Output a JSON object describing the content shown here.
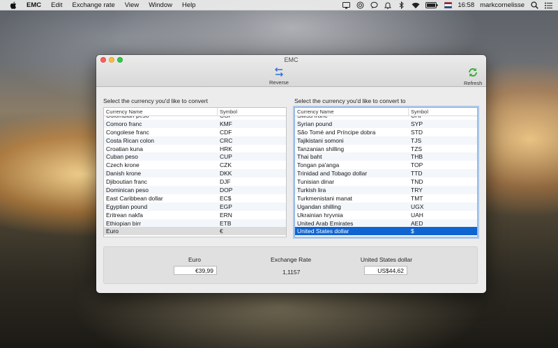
{
  "menubar": {
    "apple": "apple-logo",
    "items": [
      "EMC",
      "Edit",
      "Exchange rate",
      "View",
      "Window",
      "Help"
    ],
    "clock": "16:58",
    "user": "markcornelisse"
  },
  "window": {
    "title": "EMC",
    "toolbar": {
      "reverse_label": "Reverse",
      "refresh_label": "Refresh"
    },
    "left": {
      "title": "Select the currency you'd like to convert",
      "col_name": "Currency Name",
      "col_symbol": "Symbol",
      "rows": [
        {
          "name": "Colombian peso",
          "symbol": "COP"
        },
        {
          "name": "Comoro franc",
          "symbol": "KMF"
        },
        {
          "name": "Congolese franc",
          "symbol": "CDF"
        },
        {
          "name": "Costa Rican colon",
          "symbol": "CRC"
        },
        {
          "name": "Croatian kuna",
          "symbol": "HRK"
        },
        {
          "name": "Cuban peso",
          "symbol": "CUP"
        },
        {
          "name": "Czech krone",
          "symbol": "CZK"
        },
        {
          "name": "Danish krone",
          "symbol": "DKK"
        },
        {
          "name": "Djiboutian franc",
          "symbol": "DJF"
        },
        {
          "name": "Dominican peso",
          "symbol": "DOP"
        },
        {
          "name": "East Caribbean dollar",
          "symbol": "EC$"
        },
        {
          "name": "Egyptian pound",
          "symbol": "EGP"
        },
        {
          "name": "Eritrean nakfa",
          "symbol": "ERN"
        },
        {
          "name": "Ethiopian birr",
          "symbol": "ETB"
        },
        {
          "name": "Euro",
          "symbol": "€"
        }
      ],
      "selected": "Euro"
    },
    "right": {
      "title": "Select the currency you'd like to convert to",
      "col_name": "Currency Name",
      "col_symbol": "Symbol",
      "rows": [
        {
          "name": "Swiss franc",
          "symbol": "CHF"
        },
        {
          "name": "Syrian pound",
          "symbol": "SYP"
        },
        {
          "name": "São Tomé and Príncipe dobra",
          "symbol": "STD"
        },
        {
          "name": "Tajikistani somoni",
          "symbol": "TJS"
        },
        {
          "name": "Tanzanian shilling",
          "symbol": "TZS"
        },
        {
          "name": "Thai baht",
          "symbol": "THB"
        },
        {
          "name": "Tongan pa'anga",
          "symbol": "TOP"
        },
        {
          "name": "Trinidad and Tobago dollar",
          "symbol": "TTD"
        },
        {
          "name": "Tunisian dinar",
          "symbol": "TND"
        },
        {
          "name": "Turkish lira",
          "symbol": "TRY"
        },
        {
          "name": "Turkmenistani manat",
          "symbol": "TMT"
        },
        {
          "name": "Ugandan shilling",
          "symbol": "UGX"
        },
        {
          "name": "Ukrainian hryvnia",
          "symbol": "UAH"
        },
        {
          "name": "United Arab Emirates",
          "symbol": "AED"
        },
        {
          "name": "United States dollar",
          "symbol": "$"
        }
      ],
      "selected": "United States dollar"
    },
    "converter": {
      "from_label": "Euro",
      "from_value": "€39,99",
      "rate_label": "Exchange Rate",
      "rate_value": "1,1157",
      "to_label": "United States dollar",
      "to_value": "US$44,62"
    }
  },
  "colors": {
    "selection_blue": "#0f64d2",
    "selection_gray": "#dcdcdc",
    "toolbar_icon_blue": "#2f6fd6",
    "refresh_green": "#3cae3c"
  }
}
